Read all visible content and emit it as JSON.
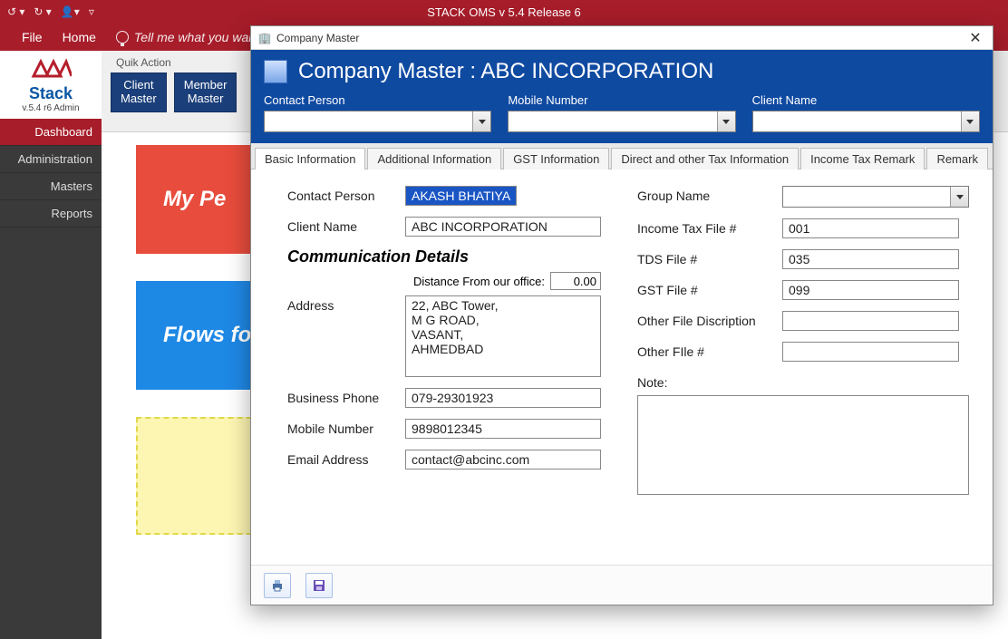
{
  "app": {
    "title": "STACK OMS v 5.4 Release 6"
  },
  "ribbon": {
    "file": "File",
    "home": "Home",
    "tellme": "Tell me what you wan"
  },
  "brand": {
    "name": "Stack",
    "version": "v.5.4 r6   Admin"
  },
  "nav": {
    "items": [
      "Dashboard",
      "Administration",
      "Masters",
      "Reports"
    ],
    "active": 0
  },
  "quick": {
    "label": "Quik Action",
    "btn1_l1": "Client",
    "btn1_l2": "Master",
    "btn2_l1": "Member",
    "btn2_l2": "Master"
  },
  "cards": {
    "red": "My Pe",
    "blue": "Flows for "
  },
  "dialog": {
    "window_title": "Company Master",
    "heading": "Company Master :  ABC INCORPORATION",
    "filters": {
      "contact_label": "Contact Person",
      "mobile_label": "Mobile Number",
      "client_label": "Client Name"
    },
    "tabs": [
      "Basic Information",
      "Additional Information",
      "GST Information",
      "Direct and other Tax Information",
      "Income Tax Remark",
      "Remark"
    ],
    "active_tab": 0,
    "form": {
      "contact_person_label": "Contact Person",
      "contact_person": "AKASH BHATIYA",
      "client_name_label": "Client Name",
      "client_name": "ABC INCORPORATION",
      "comm_section": "Communication Details",
      "distance_label": "Distance From our office:",
      "distance": "0.00",
      "address_label": "Address",
      "address": "22, ABC Tower,\nM G ROAD,\nVASANT,\nAHMEDBAD",
      "bphone_label": "Business Phone",
      "bphone": "079-29301923",
      "mobile_label": "Mobile Number",
      "mobile": "9898012345",
      "email_label": "Email Address",
      "email": "contact@abcinc.com",
      "group_label": "Group Name",
      "group": "",
      "it_file_label": "Income Tax File #",
      "it_file": "001",
      "tds_label": "TDS File #",
      "tds": "035",
      "gst_label": "GST File #",
      "gst": "099",
      "other_desc_label": "Other File Discription",
      "other_desc": "",
      "other_file_label": "Other FIle #",
      "other_file": "",
      "note_label": "Note:",
      "note": ""
    }
  }
}
